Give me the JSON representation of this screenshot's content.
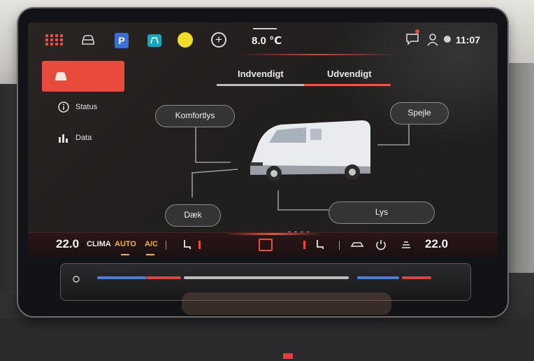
{
  "status_bar": {
    "outside_temp": "8.0 ℃",
    "time": "11:07",
    "park_label": "P"
  },
  "sidebar": {
    "items": [
      {
        "label": "Status"
      },
      {
        "label": "Data"
      }
    ]
  },
  "tabs": [
    {
      "label": "Indvendigt",
      "active": false
    },
    {
      "label": "Udvendigt",
      "active": true
    }
  ],
  "diagram": {
    "labels": {
      "komfortlys": "Komfortlys",
      "spejle": "Spejle",
      "daek": "Dæk",
      "lys": "Lys"
    }
  },
  "climate_bar": {
    "left_temp": "22.0",
    "clima": "CLIMA",
    "auto": "AUTO",
    "ac": "A/C",
    "right_temp": "22.0"
  },
  "colors": {
    "accent_red": "#e84a3c",
    "active_tab": "#e85a3f",
    "auto_yellow": "#f4b62f"
  }
}
